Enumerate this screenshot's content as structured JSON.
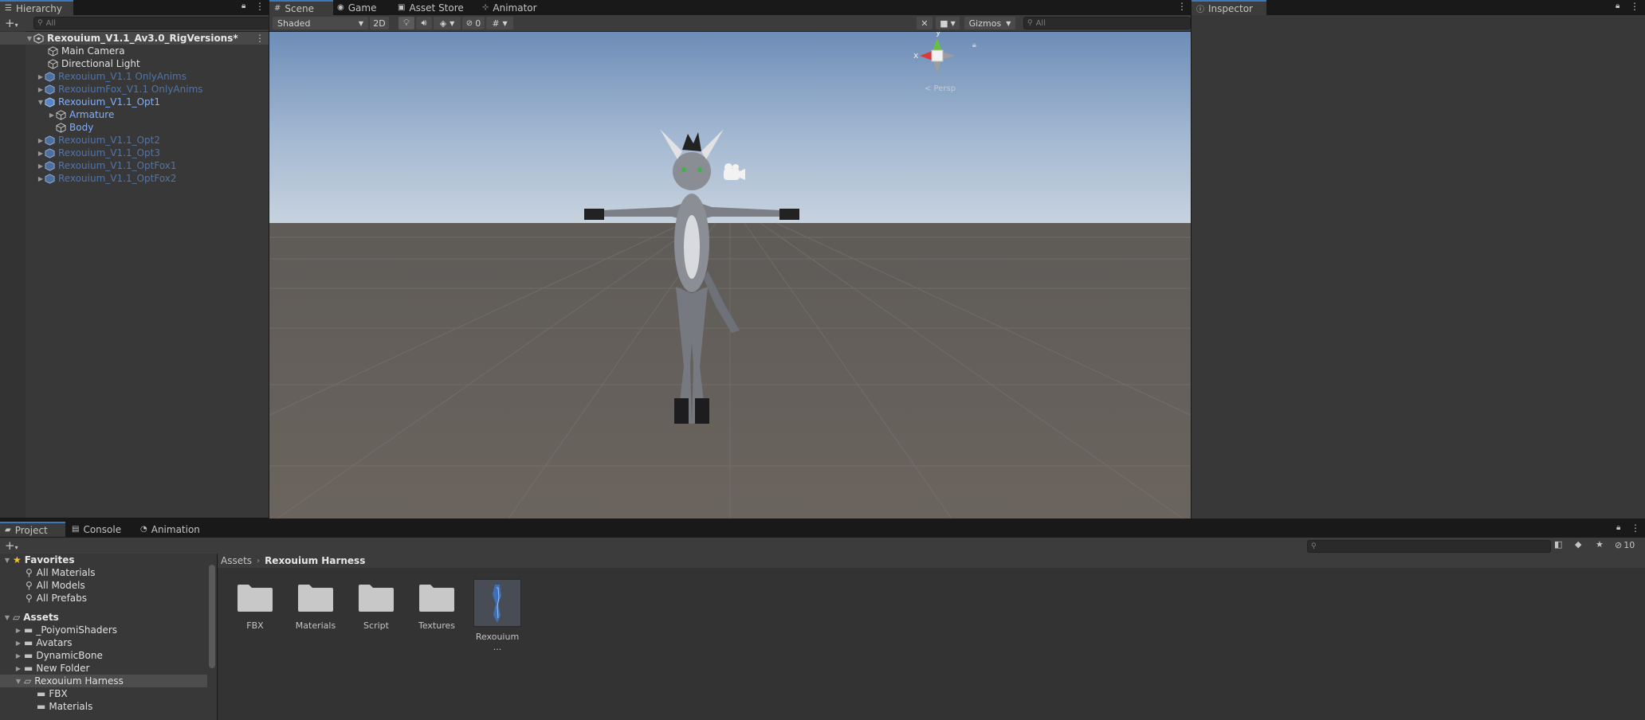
{
  "hierarchy": {
    "tab_label": "Hierarchy",
    "search_placeholder": "All",
    "scene_name": "Rexouium_V1.1_Av3.0_RigVersions*",
    "items": [
      {
        "label": "Main Camera"
      },
      {
        "label": "Directional Light"
      },
      {
        "label": "Rexouium_V1.1 OnlyAnims"
      },
      {
        "label": "RexouiumFox_V1.1 OnlyAnims"
      },
      {
        "label": "Rexouium_V1.1_Opt1"
      },
      {
        "label": "Armature"
      },
      {
        "label": "Body"
      },
      {
        "label": "Rexouium_V1.1_Opt2"
      },
      {
        "label": "Rexouium_V1.1_Opt3"
      },
      {
        "label": "Rexouium_V1.1_OptFox1"
      },
      {
        "label": "Rexouium_V1.1_OptFox2"
      }
    ]
  },
  "scene": {
    "tabs": [
      {
        "label": "Scene",
        "icon": "grid-icon"
      },
      {
        "label": "Game",
        "icon": "gamepad-icon"
      },
      {
        "label": "Asset Store",
        "icon": "bag-icon"
      },
      {
        "label": "Animator",
        "icon": "animator-icon"
      }
    ],
    "shading_mode": "Shaded",
    "mode_2d": "2D",
    "hidden_count": "0",
    "gizmos_label": "Gizmos",
    "search_placeholder": "All",
    "gizmo_x": "x",
    "gizmo_y": "y",
    "persp_label": "< Persp"
  },
  "inspector": {
    "tab_label": "Inspector"
  },
  "project": {
    "tabs": [
      {
        "label": "Project"
      },
      {
        "label": "Console"
      },
      {
        "label": "Animation"
      }
    ],
    "badge_count": "10",
    "favorites_label": "Favorites",
    "favorites": [
      "All Materials",
      "All Models",
      "All Prefabs"
    ],
    "assets_label": "Assets",
    "asset_folders": [
      "_PoiyomiShaders",
      "Avatars",
      "DynamicBone",
      "New Folder",
      "Rexouium Harness",
      "FBX",
      "Materials"
    ],
    "breadcrumb": [
      "Assets",
      "Rexouium Harness"
    ],
    "grid_items": [
      "FBX",
      "Materials",
      "Script",
      "Textures",
      "Rexouium ..."
    ]
  },
  "colors": {
    "accent": "#3a79bb",
    "selected_row": "#4d4d4d",
    "panel_bg": "#383838",
    "prefab_blue": "#7b9fd6"
  }
}
